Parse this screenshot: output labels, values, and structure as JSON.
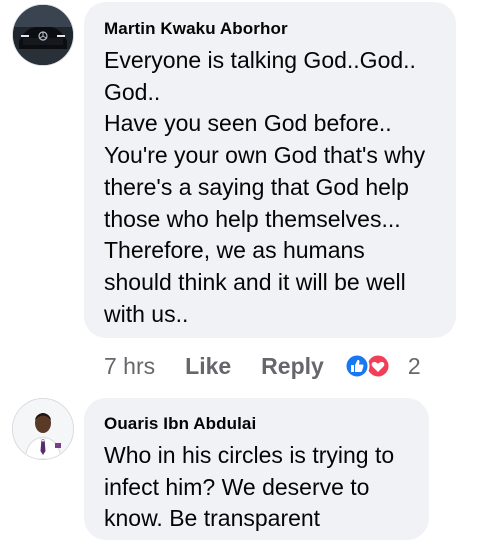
{
  "comments": [
    {
      "author": "Martin Kwaku Aborhor",
      "lines": [
        "Everyone is talking God..God..",
        "God..",
        "Have you seen God before..",
        "You're your own God that's why",
        "there's a saying that God help",
        "those who help themselves...",
        "Therefore, we as humans",
        "should think and it will be well",
        "with us.."
      ],
      "time": "7 hrs",
      "like_label": "Like",
      "reply_label": "Reply",
      "reaction_count": "2",
      "reactions": [
        "like",
        "love"
      ]
    },
    {
      "author": "Ouaris Ibn Abdulai",
      "lines": [
        "Who in his circles is trying to",
        "infect him? We deserve to",
        "know. Be transparent"
      ]
    }
  ],
  "colors": {
    "bubble": "#f0f2f5",
    "meta_text": "#65676b",
    "like_blue": "#1877f2",
    "love_red": "#f33e58"
  }
}
